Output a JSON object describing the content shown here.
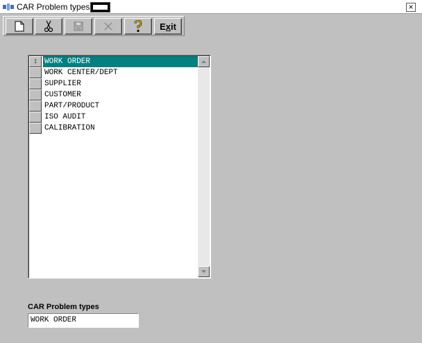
{
  "window": {
    "title": "CAR Problem types",
    "close_glyph": "×"
  },
  "toolbar": {
    "buttons": [
      {
        "name": "new-button",
        "icon": "new-document-icon",
        "enabled": true
      },
      {
        "name": "cut-button",
        "icon": "scissors-icon",
        "enabled": true
      },
      {
        "name": "save-button",
        "icon": "floppy-disk-icon",
        "enabled": false
      },
      {
        "name": "delete-button",
        "icon": "x-mark-icon",
        "enabled": false
      },
      {
        "name": "help-button",
        "icon": "question-mark-icon",
        "enabled": true
      }
    ],
    "exit_label_pre": "E",
    "exit_label_u": "x",
    "exit_label_post": "it"
  },
  "list": {
    "selected_index": 0,
    "selector_glyph": "↕",
    "items": [
      "WORK ORDER",
      "WORK CENTER/DEPT",
      "SUPPLIER",
      "CUSTOMER",
      "PART/PRODUCT",
      "ISO AUDIT",
      "CALIBRATION"
    ]
  },
  "field": {
    "label": "CAR Problem types",
    "value": "WORK ORDER"
  },
  "colors": {
    "selection": "#008080",
    "background": "#c0c0c0"
  }
}
